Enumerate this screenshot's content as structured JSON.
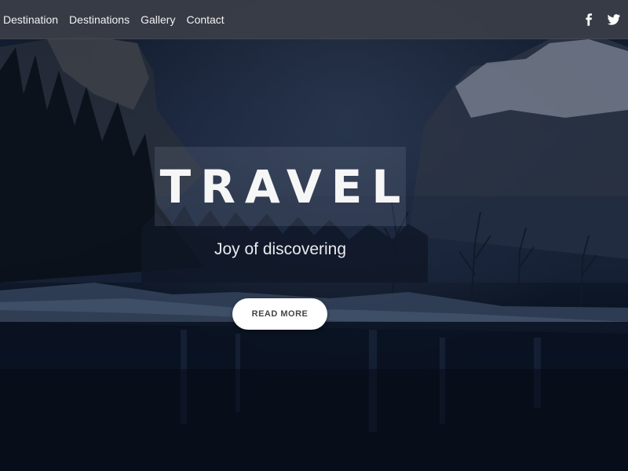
{
  "nav": {
    "links": [
      "Destination",
      "Destinations",
      "Gallery",
      "Contact"
    ],
    "social": [
      {
        "icon": "facebook-icon",
        "label": "f"
      },
      {
        "icon": "twitter-icon"
      }
    ]
  },
  "hero": {
    "title": "TRAVEL",
    "subtitle": "Joy of discovering",
    "button_label": "READ MORE"
  },
  "colors": {
    "navbar_bg": "#3a3e48",
    "button_bg": "#ffffff",
    "button_text": "#444444",
    "title_box_bg": "rgba(130,140,160,0.20)"
  }
}
